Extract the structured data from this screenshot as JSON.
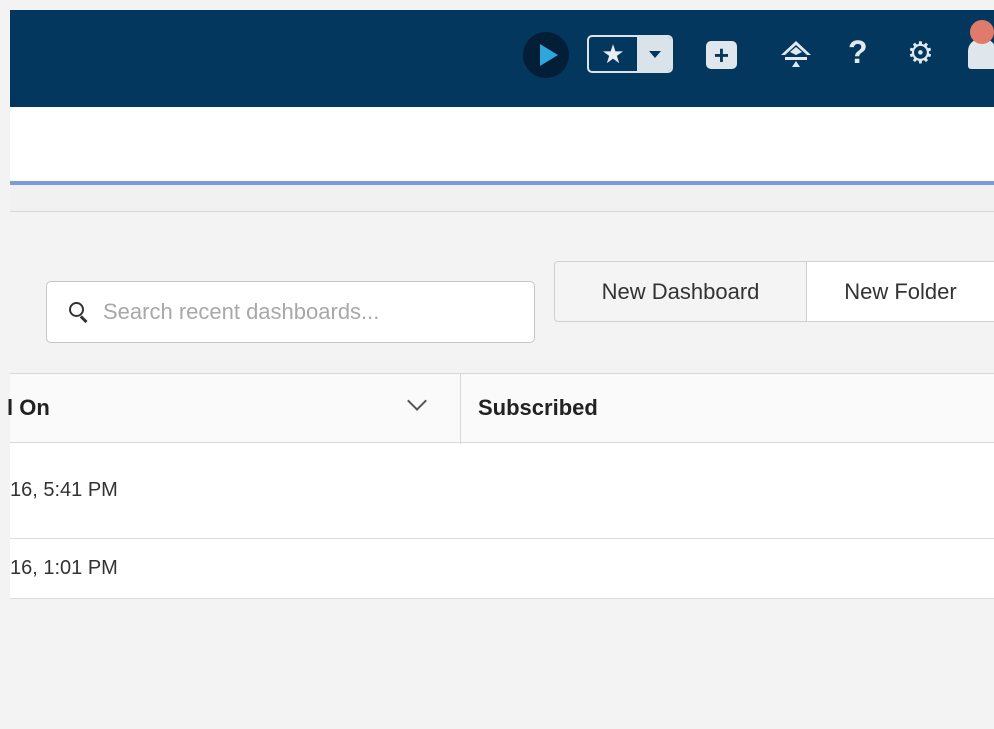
{
  "header": {
    "bg_color": "#03375d",
    "icons": [
      "play-icon",
      "star-icon",
      "chevron-down-icon",
      "plus-icon",
      "trailhead-icon",
      "help-icon",
      "gear-icon",
      "bell-icon"
    ],
    "help_glyph": "?",
    "gear_glyph": "⚙",
    "star_glyph": "★",
    "plus_glyph": "+"
  },
  "search": {
    "placeholder": "Search recent dashboards..."
  },
  "actions": {
    "new_dashboard": "New Dashboard",
    "new_folder": "New Folder"
  },
  "table": {
    "columns": [
      "l On",
      "Subscribed"
    ],
    "rows": [
      {
        "created_on": "16, 5:41 PM",
        "subscribed": ""
      },
      {
        "created_on": "16, 1:01 PM",
        "subscribed": ""
      }
    ]
  },
  "colors": {
    "accent_line": "#7c9ae0",
    "play_icon": "#2ea6dd"
  }
}
